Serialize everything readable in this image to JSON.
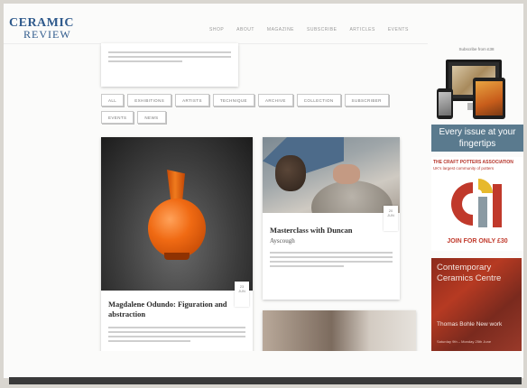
{
  "logo": {
    "line1": "CERAMIC",
    "line2": "REVIEW"
  },
  "nav": [
    "SHOP",
    "ABOUT",
    "MAGAZINE",
    "SUBSCRIBE",
    "ARTICLES",
    "EVENTS"
  ],
  "filters": [
    "ALL",
    "EXHIBITIONS",
    "ARTISTS",
    "TECHNIQUE",
    "ARCHIVE",
    "COLLECTION",
    "SUBSCRIBER",
    "EVENTS",
    "NEWS"
  ],
  "card1": {
    "title": "Magdalene Odundo: Figuration and abstraction",
    "date_day": "23",
    "date_month": "JUN"
  },
  "card2": {
    "title": "Masterclass with Duncan",
    "subtitle": "Ayscough",
    "date_day": "20",
    "date_month": "JUN"
  },
  "sidebar": {
    "title": "Subscribe from £38",
    "every_issue": "Every issue at your fingertips",
    "cpa_header": "THE CRAFT POTTERS ASSOCIATION",
    "cpa_sub": "UK's largest community of potters",
    "cpa_join": "JOIN FOR ONLY £30",
    "ccc_title": "Contemporary Ceramics Centre",
    "ccc_artist": "Thomas Bohle New work",
    "ccc_dates": "Saturday 9th – Monday 25th June"
  },
  "colors": {
    "brand_blue": "#2f5a8c",
    "cpa_red": "#c0392b",
    "vase_orange": "#f06a13"
  }
}
